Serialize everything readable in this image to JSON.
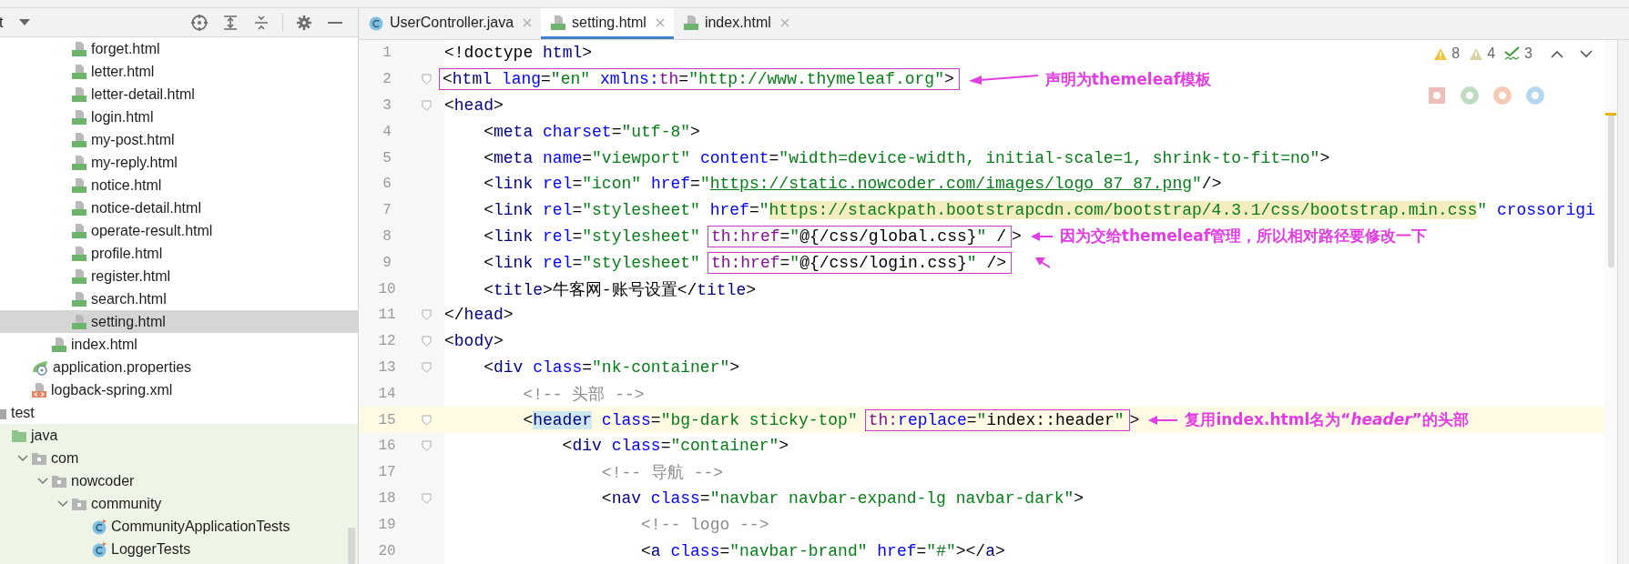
{
  "project_panel": {
    "title": "t",
    "tree": [
      {
        "kind": "folder",
        "children": [
          {
            "kind": "folder",
            "children": [
              {
                "kind": "folder",
                "children": [
                  {
                    "kind": "folder",
                    "children": [
                      {
                        "kind": "html",
                        "label": "forget.html",
                        "selected": false
                      },
                      {
                        "kind": "html",
                        "label": "letter.html",
                        "selected": false
                      },
                      {
                        "kind": "html",
                        "label": "letter-detail.html",
                        "selected": false
                      },
                      {
                        "kind": "html",
                        "label": "login.html",
                        "selected": false
                      },
                      {
                        "kind": "html",
                        "label": "my-post.html",
                        "selected": false
                      },
                      {
                        "kind": "html",
                        "label": "my-reply.html",
                        "selected": false
                      },
                      {
                        "kind": "html",
                        "label": "notice.html",
                        "selected": false
                      },
                      {
                        "kind": "html",
                        "label": "notice-detail.html",
                        "selected": false
                      },
                      {
                        "kind": "html",
                        "label": "operate-result.html",
                        "selected": false
                      },
                      {
                        "kind": "html",
                        "label": "profile.html",
                        "selected": false
                      },
                      {
                        "kind": "html",
                        "label": "register.html",
                        "selected": false
                      },
                      {
                        "kind": "html",
                        "label": "search.html",
                        "selected": false
                      },
                      {
                        "kind": "html",
                        "label": "setting.html",
                        "selected": true
                      }
                    ]
                  },
                  {
                    "kind": "html",
                    "label": "index.html",
                    "selected": false
                  }
                ]
              },
              {
                "kind": "properties",
                "label": "application.properties",
                "selected": false
              },
              {
                "kind": "xml",
                "label": "logback-spring.xml",
                "selected": false
              }
            ]
          }
        ]
      },
      {
        "kind": "folder",
        "label": "test",
        "selected": false,
        "children": [
          {
            "kind": "test-root",
            "label": "java",
            "selected": false,
            "children": [
              {
                "kind": "package",
                "label": "com",
                "selected": false,
                "expanded": true,
                "children": [
                  {
                    "kind": "package",
                    "label": "nowcoder",
                    "selected": false,
                    "expanded": true,
                    "children": [
                      {
                        "kind": "package",
                        "label": "community",
                        "selected": false,
                        "expanded": true,
                        "children": [
                          {
                            "kind": "test-class",
                            "label": "CommunityApplicationTests",
                            "selected": false
                          },
                          {
                            "kind": "test-class",
                            "label": "LoggerTests",
                            "selected": false
                          }
                        ]
                      }
                    ]
                  }
                ]
              }
            ]
          }
        ]
      }
    ]
  },
  "tabs": [
    {
      "kind": "java",
      "label": "UserController.java",
      "selected": false
    },
    {
      "kind": "html",
      "label": "setting.html",
      "selected": true
    },
    {
      "kind": "html",
      "label": "index.html",
      "selected": false
    }
  ],
  "inspections": [
    {
      "kind": "warning",
      "count": "8"
    },
    {
      "kind": "weak-warning",
      "count": "4"
    },
    {
      "kind": "typo",
      "count": "3"
    }
  ],
  "browsers": [
    {
      "kind": "ide"
    },
    {
      "kind": "chrome"
    },
    {
      "kind": "firefox"
    },
    {
      "kind": "edge"
    }
  ],
  "lines": [
    {
      "number": "1",
      "fold": false,
      "current": false,
      "parts": [
        {
          "kind": "punct",
          "text": "<!doctype "
        },
        {
          "kind": "tag",
          "text": "html"
        },
        {
          "kind": "punct",
          "text": ">"
        }
      ]
    },
    {
      "number": "2",
      "fold": true,
      "current": false,
      "arrow": {
        "kind": "long-left"
      },
      "note": "声明为themeleaf模板",
      "parts": [
        {
          "kind": "box",
          "parts": [
            {
              "kind": "punct",
              "text": "<"
            },
            {
              "kind": "tag",
              "text": "html"
            },
            {
              "kind": "attr",
              "text": " lang"
            },
            {
              "kind": "punct",
              "text": "="
            },
            {
              "kind": "value",
              "text": "\"en\""
            },
            {
              "kind": "attr",
              "text": " xmlns:"
            },
            {
              "kind": "ns",
              "text": "th"
            },
            {
              "kind": "punct",
              "text": "="
            },
            {
              "kind": "value",
              "text": "\"http://www.thymeleaf.org\""
            },
            {
              "kind": "punct",
              "text": ">"
            }
          ]
        }
      ]
    },
    {
      "number": "3",
      "fold": true,
      "current": false,
      "parts": [
        {
          "kind": "punct",
          "text": "<"
        },
        {
          "kind": "tag",
          "text": "head"
        },
        {
          "kind": "punct",
          "text": ">"
        }
      ]
    },
    {
      "number": "4",
      "fold": false,
      "current": false,
      "parts": [
        {
          "kind": "punct",
          "text": "    <"
        },
        {
          "kind": "tag",
          "text": "meta"
        },
        {
          "kind": "attr",
          "text": " charset"
        },
        {
          "kind": "punct",
          "text": "="
        },
        {
          "kind": "value",
          "text": "\"utf-8\""
        },
        {
          "kind": "punct",
          "text": ">"
        }
      ]
    },
    {
      "number": "5",
      "fold": false,
      "current": false,
      "parts": [
        {
          "kind": "punct",
          "text": "    <"
        },
        {
          "kind": "tag",
          "text": "meta"
        },
        {
          "kind": "attr",
          "text": " name"
        },
        {
          "kind": "punct",
          "text": "="
        },
        {
          "kind": "value",
          "text": "\"viewport\""
        },
        {
          "kind": "attr",
          "text": " content"
        },
        {
          "kind": "punct",
          "text": "="
        },
        {
          "kind": "value",
          "text": "\"width=device-width, initial-scale=1, shrink-to-fit=no\""
        },
        {
          "kind": "punct",
          "text": ">"
        }
      ]
    },
    {
      "number": "6",
      "fold": false,
      "current": false,
      "parts": [
        {
          "kind": "punct",
          "text": "    <"
        },
        {
          "kind": "tag",
          "text": "link"
        },
        {
          "kind": "attr",
          "text": " rel"
        },
        {
          "kind": "punct",
          "text": "="
        },
        {
          "kind": "value",
          "text": "\"icon\""
        },
        {
          "kind": "attr",
          "text": " href"
        },
        {
          "kind": "punct",
          "text": "="
        },
        {
          "kind": "value",
          "text": "\""
        },
        {
          "kind": "link",
          "text": "https://static.nowcoder.com/images/logo_87_87.png"
        },
        {
          "kind": "value",
          "text": "\""
        },
        {
          "kind": "punct",
          "text": "/>"
        }
      ]
    },
    {
      "number": "7",
      "fold": false,
      "current": false,
      "parts": [
        {
          "kind": "punct",
          "text": "    <"
        },
        {
          "kind": "tag",
          "text": "link"
        },
        {
          "kind": "attr",
          "text": " rel"
        },
        {
          "kind": "punct",
          "text": "="
        },
        {
          "kind": "value",
          "text": "\"stylesheet\""
        },
        {
          "kind": "attr",
          "text": " href"
        },
        {
          "kind": "punct",
          "text": "="
        },
        {
          "kind": "value",
          "text": "\""
        },
        {
          "kind": "value",
          "text": "https://stackpath.bootstrapcdn.com/bootstrap/4.3.1/css/bootstrap.min.css",
          "highlighted": true
        },
        {
          "kind": "value",
          "text": "\""
        },
        {
          "kind": "attr",
          "text": " crossorigi"
        }
      ]
    },
    {
      "number": "8",
      "fold": false,
      "current": false,
      "arrow": {
        "kind": "short-left"
      },
      "note": "因为交给themeleaf管理，所以相对路径要修改一下",
      "parts": [
        {
          "kind": "punct",
          "text": "    <"
        },
        {
          "kind": "tag",
          "text": "link"
        },
        {
          "kind": "attr",
          "text": " rel"
        },
        {
          "kind": "punct",
          "text": "="
        },
        {
          "kind": "value",
          "text": "\"stylesheet\""
        },
        {
          "kind": "box",
          "parts": [
            {
              "kind": "ns",
              "text": "th:href"
            },
            {
              "kind": "punct",
              "text": "="
            },
            {
              "kind": "value",
              "text": "\""
            },
            {
              "kind": "text",
              "text": "@{/css/global.css}"
            },
            {
              "kind": "value",
              "text": "\""
            },
            {
              "kind": "punct",
              "text": " /"
            }
          ]
        },
        {
          "kind": "punct",
          "text": ">"
        }
      ]
    },
    {
      "number": "9",
      "fold": false,
      "current": false,
      "arrow": {
        "kind": "up-left"
      },
      "parts": [
        {
          "kind": "punct",
          "text": "    <"
        },
        {
          "kind": "tag",
          "text": "link"
        },
        {
          "kind": "attr",
          "text": " rel"
        },
        {
          "kind": "punct",
          "text": "="
        },
        {
          "kind": "value",
          "text": "\"stylesheet\""
        },
        {
          "kind": "box",
          "parts": [
            {
              "kind": "ns",
              "text": "th:href"
            },
            {
              "kind": "punct",
              "text": "="
            },
            {
              "kind": "value",
              "text": "\""
            },
            {
              "kind": "text",
              "text": "@{/css/login.css}"
            },
            {
              "kind": "value",
              "text": "\""
            },
            {
              "kind": "punct",
              "text": " />"
            }
          ]
        }
      ]
    },
    {
      "number": "10",
      "fold": false,
      "current": false,
      "parts": [
        {
          "kind": "punct",
          "text": "    <"
        },
        {
          "kind": "tag",
          "text": "title"
        },
        {
          "kind": "punct",
          "text": ">"
        },
        {
          "kind": "text",
          "text": "牛客网-账号设置"
        },
        {
          "kind": "punct",
          "text": "</"
        },
        {
          "kind": "tag",
          "text": "title"
        },
        {
          "kind": "punct",
          "text": ">"
        }
      ]
    },
    {
      "number": "11",
      "fold": true,
      "current": false,
      "parts": [
        {
          "kind": "punct",
          "text": "</"
        },
        {
          "kind": "tag",
          "text": "head"
        },
        {
          "kind": "punct",
          "text": ">"
        }
      ]
    },
    {
      "number": "12",
      "fold": true,
      "current": false,
      "parts": [
        {
          "kind": "punct",
          "text": "<"
        },
        {
          "kind": "tag",
          "text": "body"
        },
        {
          "kind": "punct",
          "text": ">"
        }
      ]
    },
    {
      "number": "13",
      "fold": true,
      "current": false,
      "parts": [
        {
          "kind": "punct",
          "text": "    <"
        },
        {
          "kind": "tag",
          "text": "div"
        },
        {
          "kind": "attr",
          "text": " class"
        },
        {
          "kind": "punct",
          "text": "="
        },
        {
          "kind": "value",
          "text": "\"nk-container\""
        },
        {
          "kind": "punct",
          "text": ">"
        }
      ]
    },
    {
      "number": "14",
      "fold": false,
      "current": false,
      "parts": [
        {
          "kind": "comment",
          "text": "        <!-- 头部 -->"
        }
      ]
    },
    {
      "number": "15",
      "fold": true,
      "current": true,
      "arrow": {
        "kind": "medium-left"
      },
      "note": "复用index.html名为“*header*”的头部",
      "parts": [
        {
          "kind": "punct",
          "text": "        <"
        },
        {
          "kind": "tag",
          "text": "header",
          "highlighted": true
        },
        {
          "kind": "attr",
          "text": " class"
        },
        {
          "kind": "punct",
          "text": "="
        },
        {
          "kind": "value",
          "text": "\"bg-dark sticky-top\""
        },
        {
          "kind": "box",
          "parts": [
            {
              "kind": "ns",
              "text": "th:"
            },
            {
              "kind": "attr",
              "text": "replace"
            },
            {
              "kind": "punct",
              "text": "="
            },
            {
              "kind": "value",
              "text": "\""
            },
            {
              "kind": "text",
              "text": "index::header"
            },
            {
              "kind": "value",
              "text": "\""
            }
          ]
        },
        {
          "kind": "punct",
          "text": ">"
        }
      ]
    },
    {
      "number": "16",
      "fold": true,
      "current": false,
      "parts": [
        {
          "kind": "punct",
          "text": "            <"
        },
        {
          "kind": "tag",
          "text": "div"
        },
        {
          "kind": "attr",
          "text": " class"
        },
        {
          "kind": "punct",
          "text": "="
        },
        {
          "kind": "value",
          "text": "\"container\""
        },
        {
          "kind": "punct",
          "text": ">"
        }
      ]
    },
    {
      "number": "17",
      "fold": false,
      "current": false,
      "parts": [
        {
          "kind": "comment",
          "text": "                <!-- 导航 -->"
        }
      ]
    },
    {
      "number": "18",
      "fold": true,
      "current": false,
      "parts": [
        {
          "kind": "punct",
          "text": "                <"
        },
        {
          "kind": "tag",
          "text": "nav"
        },
        {
          "kind": "attr",
          "text": " class"
        },
        {
          "kind": "punct",
          "text": "="
        },
        {
          "kind": "value",
          "text": "\"navbar navbar-expand-lg navbar-dark\""
        },
        {
          "kind": "punct",
          "text": ">"
        }
      ]
    },
    {
      "number": "19",
      "fold": false,
      "current": false,
      "parts": [
        {
          "kind": "comment",
          "text": "                    <!-- logo -->"
        }
      ]
    },
    {
      "number": "20",
      "fold": false,
      "current": false,
      "parts": [
        {
          "kind": "punct",
          "text": "                    <"
        },
        {
          "kind": "tag",
          "text": "a"
        },
        {
          "kind": "attr",
          "text": " class"
        },
        {
          "kind": "punct",
          "text": "="
        },
        {
          "kind": "value",
          "text": "\"navbar-brand\""
        },
        {
          "kind": "attr",
          "text": " href"
        },
        {
          "kind": "punct",
          "text": "="
        },
        {
          "kind": "value",
          "text": "\"#\""
        },
        {
          "kind": "punct",
          "text": "></"
        },
        {
          "kind": "tag",
          "text": "a"
        },
        {
          "kind": "punct",
          "text": ">"
        }
      ]
    }
  ]
}
